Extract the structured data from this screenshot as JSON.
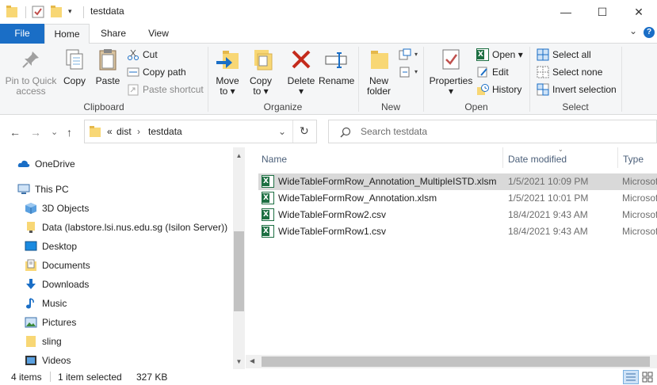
{
  "window": {
    "title": "testdata",
    "minimize_glyph": "—",
    "maximize_glyph": "☐",
    "close_glyph": "✕"
  },
  "ribbon_tabs": {
    "file": "File",
    "home": "Home",
    "share": "Share",
    "view": "View",
    "expand_glyph": "⌄",
    "help_glyph": "?"
  },
  "clipboard": {
    "label": "Clipboard",
    "pin_line1": "Pin to Quick",
    "pin_line2": "access",
    "copy": "Copy",
    "paste": "Paste",
    "cut": "Cut",
    "copy_path": "Copy path",
    "paste_shortcut": "Paste shortcut"
  },
  "organize": {
    "label": "Organize",
    "move_to_line1": "Move",
    "move_to_line2": "to ▾",
    "copy_to_line1": "Copy",
    "copy_to_line2": "to ▾",
    "delete_line1": "Delete",
    "delete_line2": "▾",
    "rename": "Rename"
  },
  "new_group": {
    "label": "New",
    "new_folder_line1": "New",
    "new_folder_line2": "folder"
  },
  "open_group": {
    "label": "Open",
    "properties_line1": "Properties",
    "properties_line2": "▾",
    "open": "Open ▾",
    "edit": "Edit",
    "history": "History"
  },
  "select_group": {
    "label": "Select",
    "select_all": "Select all",
    "select_none": "Select none",
    "invert_selection": "Invert selection"
  },
  "address": {
    "back_glyph": "←",
    "forward_glyph": "→",
    "dropdown_glyph": "⌄",
    "up_glyph": "↑",
    "overflow": "«",
    "crumb1": "dist",
    "crumb_sep": "›",
    "crumb2": "testdata",
    "address_dropdown_glyph": "⌄",
    "refresh_glyph": "↻",
    "search_placeholder": "Search testdata"
  },
  "nav_pane": {
    "items": [
      {
        "label": "OneDrive",
        "icon": "cloud-icon"
      },
      {
        "label": "This PC",
        "icon": "computer-icon"
      },
      {
        "label": "3D Objects",
        "icon": "cube-icon"
      },
      {
        "label": "Data (labstore.lsi.nus.edu.sg (Isilon Server))",
        "icon": "network-drive-icon"
      },
      {
        "label": "Desktop",
        "icon": "desktop-icon"
      },
      {
        "label": "Documents",
        "icon": "documents-icon"
      },
      {
        "label": "Downloads",
        "icon": "download-icon"
      },
      {
        "label": "Music",
        "icon": "music-icon"
      },
      {
        "label": "Pictures",
        "icon": "pictures-icon"
      },
      {
        "label": "sling",
        "icon": "folder-icon"
      },
      {
        "label": "Videos",
        "icon": "videos-icon"
      }
    ],
    "scroll_up_glyph": "▲",
    "scroll_down_glyph": "▼"
  },
  "file_list": {
    "columns": {
      "name": "Name",
      "date_modified": "Date modified",
      "type": "Type"
    },
    "rows": [
      {
        "name": "WideTableFormRow_Annotation_MultipleISTD.xlsm",
        "date": "1/5/2021 10:09 PM",
        "type": "Microsoft",
        "selected": true
      },
      {
        "name": "WideTableFormRow_Annotation.xlsm",
        "date": "1/5/2021 10:01 PM",
        "type": "Microsoft",
        "selected": false
      },
      {
        "name": "WideTableFormRow2.csv",
        "date": "18/4/2021 9:43 AM",
        "type": "Microsoft",
        "selected": false
      },
      {
        "name": "WideTableFormRow1.csv",
        "date": "18/4/2021 9:43 AM",
        "type": "Microsoft",
        "selected": false
      }
    ],
    "scroll_left_glyph": "◀",
    "scroll_right_glyph": "▶"
  },
  "status": {
    "item_count": "4 items",
    "selection": "1 item selected",
    "size": "327 KB"
  },
  "colors": {
    "file_tab": "#1a6ec6",
    "selection": "#d9d9d9",
    "folder": "#f8d775",
    "excel": "#1d6f42",
    "delete": "#c42b1c"
  }
}
